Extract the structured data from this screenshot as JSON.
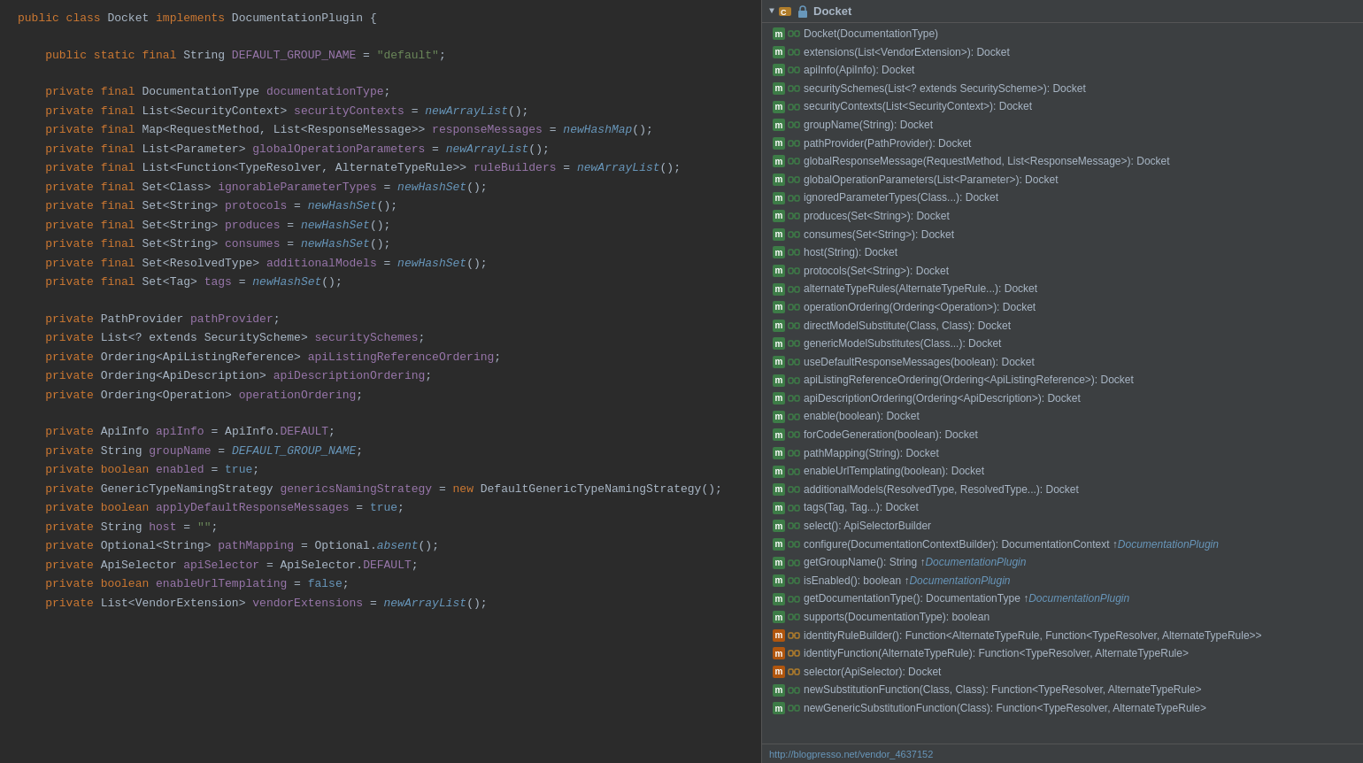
{
  "codePanel": {
    "lines": [
      {
        "id": 1,
        "content": "public class Docket implements DocumentationPlugin {",
        "type": "normal"
      },
      {
        "id": 2,
        "content": "",
        "type": "empty"
      },
      {
        "id": 3,
        "content": "    public static final String DEFAULT_GROUP_NAME = \"default\";",
        "type": "normal"
      },
      {
        "id": 4,
        "content": "",
        "type": "empty"
      },
      {
        "id": 5,
        "content": "    private final DocumentationType documentationType;",
        "type": "normal"
      },
      {
        "id": 6,
        "content": "    private final List<SecurityContext> securityContexts = newArrayList();",
        "type": "normal"
      },
      {
        "id": 7,
        "content": "    private final Map<RequestMethod, List<ResponseMessage>> responseMessages = newHashMap();",
        "type": "normal"
      },
      {
        "id": 8,
        "content": "    private final List<Parameter> globalOperationParameters = newArrayList();",
        "type": "normal"
      },
      {
        "id": 9,
        "content": "    private final List<Function<TypeResolver, AlternateTypeRule>> ruleBuilders = newArrayList();",
        "type": "normal"
      },
      {
        "id": 10,
        "content": "    private final Set<Class> ignorableParameterTypes = newHashSet();",
        "type": "normal"
      },
      {
        "id": 11,
        "content": "    private final Set<String> protocols = newHashSet();",
        "type": "normal"
      },
      {
        "id": 12,
        "content": "    private final Set<String> produces = newHashSet();",
        "type": "normal"
      },
      {
        "id": 13,
        "content": "    private final Set<String> consumes = newHashSet();",
        "type": "normal"
      },
      {
        "id": 14,
        "content": "    private final Set<ResolvedType> additionalModels = newHashSet();",
        "type": "normal"
      },
      {
        "id": 15,
        "content": "    private final Set<Tag> tags = newHashSet();",
        "type": "normal"
      },
      {
        "id": 16,
        "content": "",
        "type": "empty"
      },
      {
        "id": 17,
        "content": "    private PathProvider pathProvider;",
        "type": "normal"
      },
      {
        "id": 18,
        "content": "    private List<? extends SecurityScheme> securitySchemes;",
        "type": "normal"
      },
      {
        "id": 19,
        "content": "    private Ordering<ApiListingReference> apiListingReferenceOrdering;",
        "type": "normal"
      },
      {
        "id": 20,
        "content": "    private Ordering<ApiDescription> apiDescriptionOrdering;",
        "type": "normal"
      },
      {
        "id": 21,
        "content": "    private Ordering<Operation> operationOrdering;",
        "type": "normal"
      },
      {
        "id": 22,
        "content": "",
        "type": "empty"
      },
      {
        "id": 23,
        "content": "    private ApiInfo apiInfo = ApiInfo.DEFAULT;",
        "type": "normal"
      },
      {
        "id": 24,
        "content": "    private String groupName = DEFAULT_GROUP_NAME;",
        "type": "normal"
      },
      {
        "id": 25,
        "content": "    private boolean enabled = true;",
        "type": "normal"
      },
      {
        "id": 26,
        "content": "    private GenericTypeNamingStrategy genericsNamingStrategy = new DefaultGenericTypeNamingStrategy();",
        "type": "normal"
      },
      {
        "id": 27,
        "content": "    private boolean applyDefaultResponseMessages = true;",
        "type": "normal"
      },
      {
        "id": 28,
        "content": "    private String host = \"\";",
        "type": "normal"
      },
      {
        "id": 29,
        "content": "    private Optional<String> pathMapping = Optional.absent();",
        "type": "normal"
      },
      {
        "id": 30,
        "content": "    private ApiSelector apiSelector = ApiSelector.DEFAULT;",
        "type": "normal"
      },
      {
        "id": 31,
        "content": "    private boolean enableUrlTemplating = false;",
        "type": "normal"
      },
      {
        "id": 32,
        "content": "    private List<VendorExtension> vendorExtensions = newArrayList();",
        "type": "normal"
      }
    ]
  },
  "rightPanel": {
    "header": {
      "title": "Docket",
      "collapseIcon": "▼"
    },
    "treeItems": [
      {
        "badge": "m",
        "lock": true,
        "text": "Docket(DocumentationType)"
      },
      {
        "badge": "m",
        "lock": true,
        "text": "extensions(List<VendorExtension>): Docket"
      },
      {
        "badge": "m",
        "lock": true,
        "text": "apiInfo(ApiInfo): Docket"
      },
      {
        "badge": "m",
        "lock": true,
        "text": "securitySchemes(List<? extends SecurityScheme>): Docket"
      },
      {
        "badge": "m",
        "lock": true,
        "text": "securityContexts(List<SecurityContext>): Docket"
      },
      {
        "badge": "m",
        "lock": true,
        "text": "groupName(String): Docket"
      },
      {
        "badge": "m",
        "lock": true,
        "text": "pathProvider(PathProvider): Docket"
      },
      {
        "badge": "m",
        "lock": true,
        "text": "globalResponseMessage(RequestMethod, List<ResponseMessage>): Docket"
      },
      {
        "badge": "m",
        "lock": true,
        "text": "globalOperationParameters(List<Parameter>): Docket"
      },
      {
        "badge": "m",
        "lock": true,
        "text": "ignoredParameterTypes(Class...): Docket"
      },
      {
        "badge": "m",
        "lock": true,
        "text": "produces(Set<String>): Docket"
      },
      {
        "badge": "m",
        "lock": true,
        "text": "consumes(Set<String>): Docket"
      },
      {
        "badge": "m",
        "lock": true,
        "text": "host(String): Docket"
      },
      {
        "badge": "m",
        "lock": true,
        "text": "protocols(Set<String>): Docket"
      },
      {
        "badge": "m",
        "lock": true,
        "text": "alternateTypeRules(AlternateTypeRule...): Docket"
      },
      {
        "badge": "m",
        "lock": true,
        "text": "operationOrdering(Ordering<Operation>): Docket"
      },
      {
        "badge": "m",
        "lock": true,
        "text": "directModelSubstitute(Class, Class): Docket"
      },
      {
        "badge": "m",
        "lock": true,
        "text": "genericModelSubstitutes(Class...): Docket"
      },
      {
        "badge": "m",
        "lock": true,
        "text": "useDefaultResponseMessages(boolean): Docket"
      },
      {
        "badge": "m",
        "lock": true,
        "text": "apiListingReferenceOrdering(Ordering<ApiListingReference>): Docket"
      },
      {
        "badge": "m",
        "lock": true,
        "text": "apiDescriptionOrdering(Ordering<ApiDescription>): Docket"
      },
      {
        "badge": "m",
        "lock": true,
        "text": "enable(boolean): Docket"
      },
      {
        "badge": "m",
        "lock": true,
        "text": "forCodeGeneration(boolean): Docket"
      },
      {
        "badge": "m",
        "lock": true,
        "text": "pathMapping(String): Docket"
      },
      {
        "badge": "m",
        "lock": true,
        "text": "enableUrlTemplating(boolean): Docket"
      },
      {
        "badge": "m",
        "lock": true,
        "text": "additionalModels(ResolvedType, ResolvedType...): Docket"
      },
      {
        "badge": "m",
        "lock": true,
        "text": "tags(Tag, Tag...): Docket"
      },
      {
        "badge": "m",
        "lock": true,
        "text": "select(): ApiSelectorBuilder"
      },
      {
        "badge": "m",
        "lock": true,
        "text": "configure(DocumentationContextBuilder): DocumentationContext ↑DocumentationPlugin"
      },
      {
        "badge": "m",
        "lock": true,
        "text": "getGroupName(): String ↑DocumentationPlugin"
      },
      {
        "badge": "m",
        "lock": true,
        "text": "isEnabled(): boolean ↑DocumentationPlugin"
      },
      {
        "badge": "m",
        "lock": true,
        "text": "getDocumentationType(): DocumentationType ↑DocumentationPlugin"
      },
      {
        "badge": "m",
        "lock": true,
        "text": "supports(DocumentationType): boolean"
      },
      {
        "badge": "m",
        "lock_orange": true,
        "text": "identityRuleBuilder(): Function<AlternateTypeRule, Function<TypeResolver, AlternateTypeRule>>"
      },
      {
        "badge": "m",
        "lock_orange": true,
        "text": "identityFunction(AlternateTypeRule): Function<TypeResolver, AlternateTypeRule>"
      },
      {
        "badge": "m",
        "lock_orange": true,
        "text": "selector(ApiSelector): Docket"
      },
      {
        "badge": "m",
        "lock": true,
        "text": "newSubstitutionFunction(Class, Class): Function<TypeResolver, AlternateTypeRule>"
      },
      {
        "badge": "m",
        "lock": true,
        "text": "newGenericSubstitutionFunction(Class): Function<TypeResolver, AlternateTypeRule>"
      }
    ],
    "statusBar": {
      "text": "http://blogpresso.net/vendor_4637152"
    }
  }
}
